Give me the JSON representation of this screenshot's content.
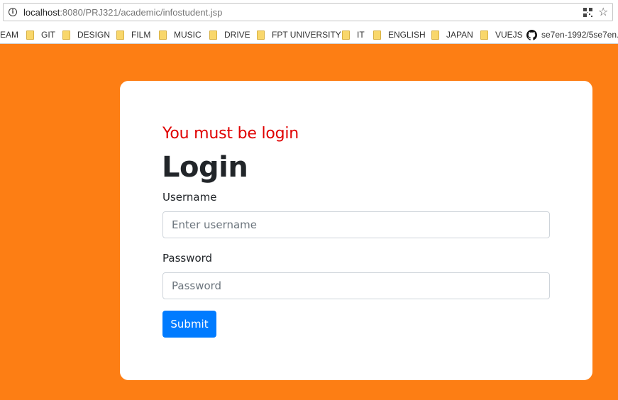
{
  "browser": {
    "url_host": "localhost",
    "url_rest": ":8080/PRJ321/academic/infostudent.jsp"
  },
  "bookmarks": [
    {
      "label": "EAM",
      "icon": "none"
    },
    {
      "label": "GIT",
      "icon": "folder-icon"
    },
    {
      "label": "DESIGN",
      "icon": "folder-icon"
    },
    {
      "label": "FILM",
      "icon": "folder-icon"
    },
    {
      "label": "MUSIC",
      "icon": "folder-icon"
    },
    {
      "label": "DRIVE",
      "icon": "folder-icon"
    },
    {
      "label": "FPT UNIVERSITY",
      "icon": "folder-icon"
    },
    {
      "label": "IT",
      "icon": "folder-icon"
    },
    {
      "label": "ENGLISH",
      "icon": "folder-icon"
    },
    {
      "label": "JAPAN",
      "icon": "folder-icon"
    },
    {
      "label": "VUEJS",
      "icon": "folder-icon"
    },
    {
      "label": "se7en-1992/5se7en.",
      "icon": "github-icon"
    }
  ],
  "page": {
    "background_color": "#fd7e14",
    "error_message": "You must be login",
    "title": "Login",
    "username_label": "Username",
    "username_placeholder": "Enter username",
    "password_label": "Password",
    "password_placeholder": "Password",
    "submit_label": "Submit",
    "error_color": "#e00000",
    "button_color": "#007bff"
  }
}
